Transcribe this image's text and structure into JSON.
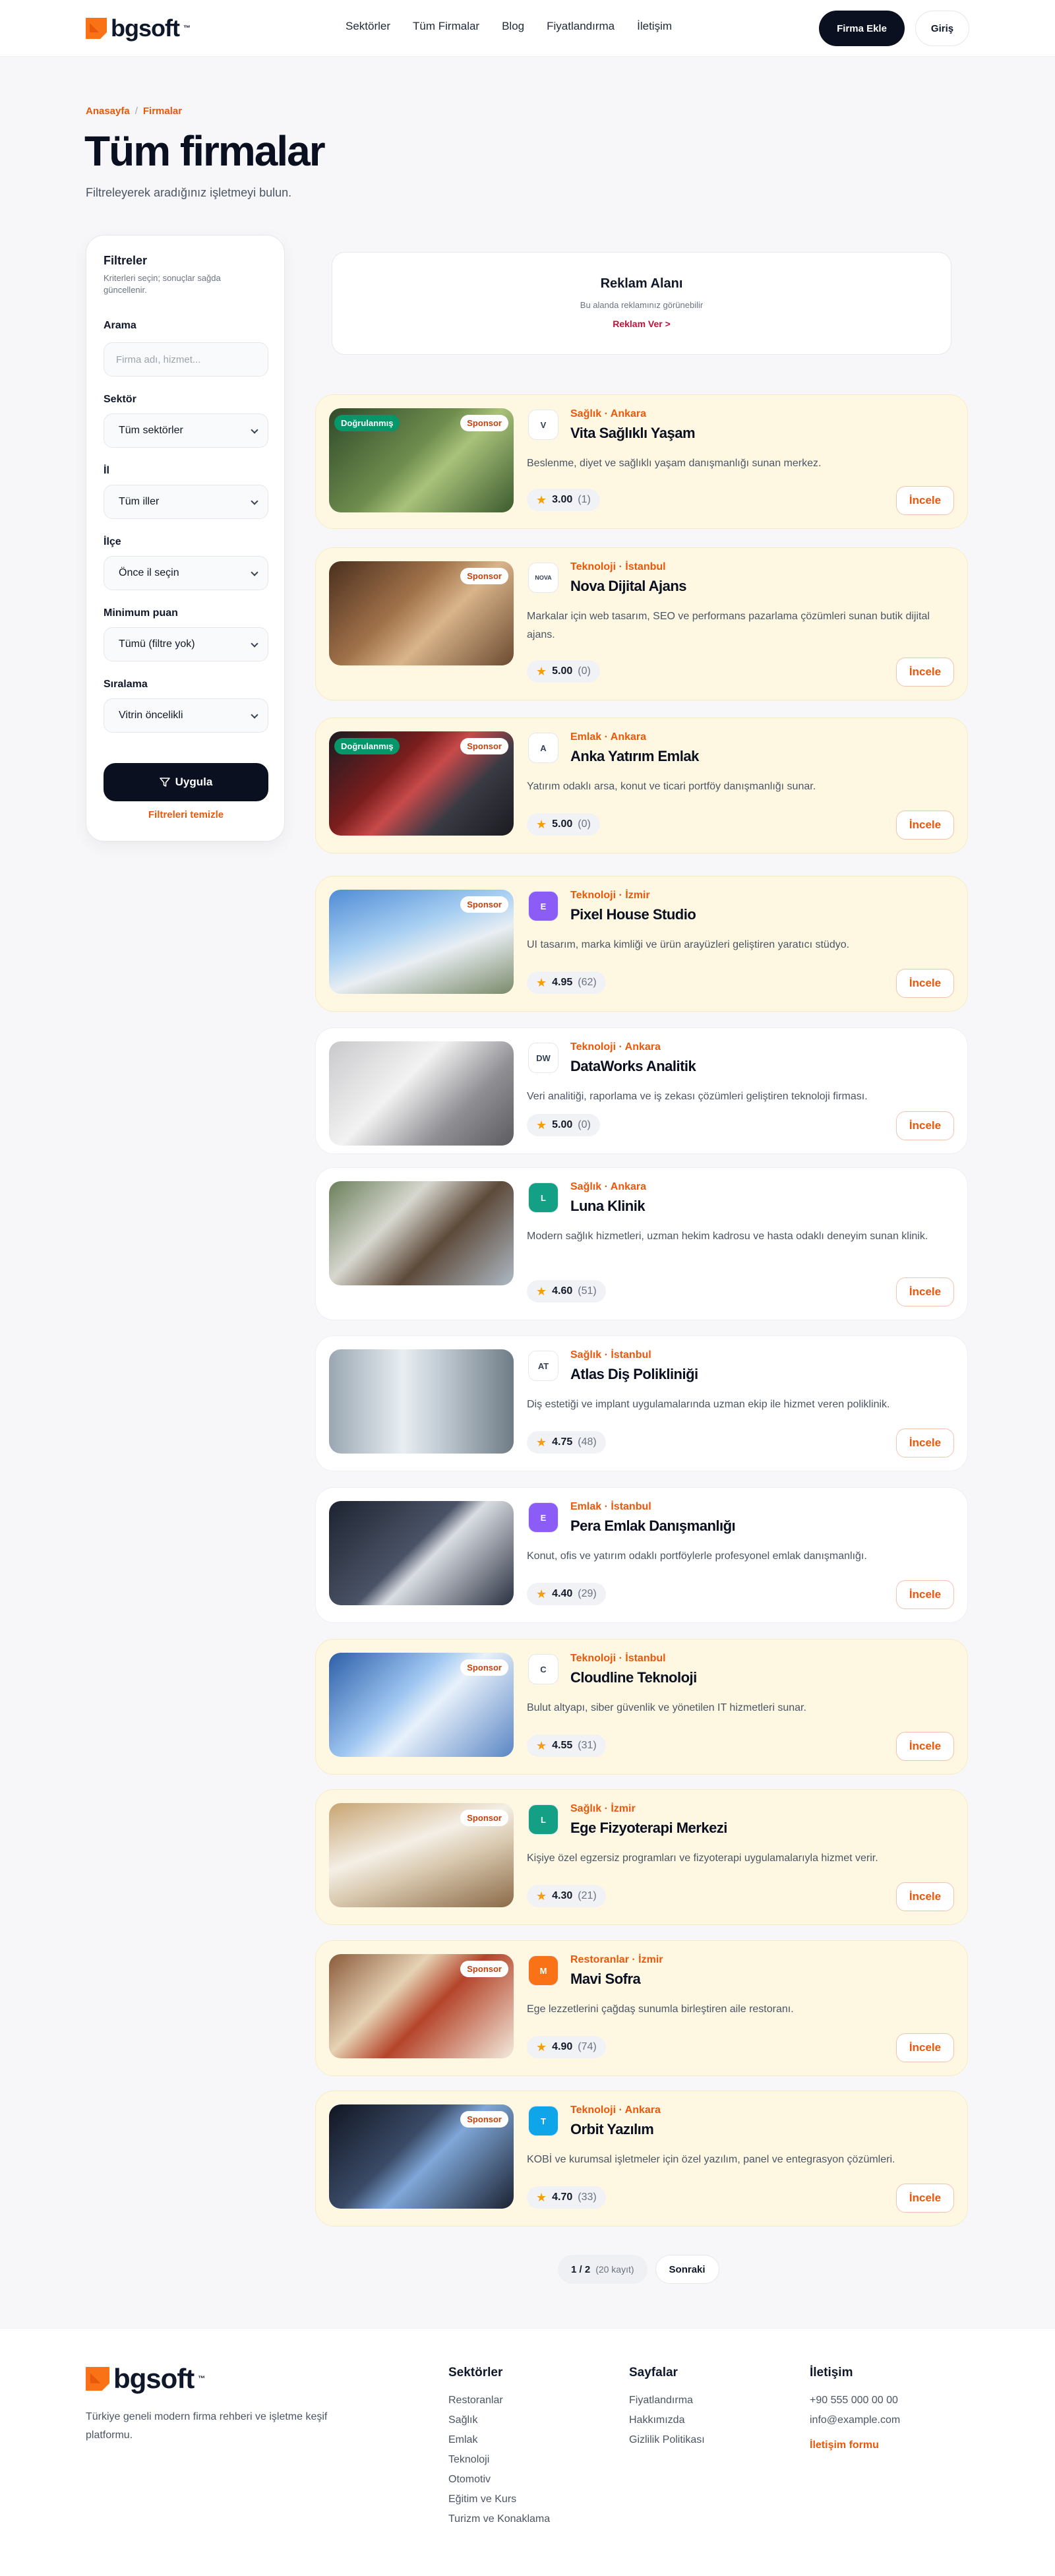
{
  "brand": {
    "name": "bgsoft",
    "tm": "™"
  },
  "nav": [
    "Sektörler",
    "Tüm Firmalar",
    "Blog",
    "Fiyatlandırma",
    "İletişim"
  ],
  "header_actions": {
    "add": "Firma Ekle",
    "login": "Giriş"
  },
  "breadcrumb": {
    "home": "Anasayfa",
    "sep": "/",
    "current": "Firmalar"
  },
  "page": {
    "title": "Tüm firmalar",
    "subtitle": "Filtreleyerek aradığınız işletmeyi bulun."
  },
  "filters": {
    "title": "Filtreler",
    "desc": "Kriterleri seçin; sonuçlar sağda güncellenir.",
    "search_label": "Arama",
    "search_placeholder": "Firma adı, hizmet...",
    "sector_label": "Sektör",
    "sector_value": "Tüm sektörler",
    "city_label": "İl",
    "city_value": "Tüm iller",
    "district_label": "İlçe",
    "district_value": "Önce il seçin",
    "rating_label": "Minimum puan",
    "rating_value": "Tümü (filtre yok)",
    "sort_label": "Sıralama",
    "sort_value": "Vitrin öncelikli",
    "apply": "Uygula",
    "clear": "Filtreleri temizle"
  },
  "ad": {
    "title": "Reklam Alanı",
    "desc": "Bu alanda reklamınız görünebilir",
    "link": "Reklam Ver >"
  },
  "badges": {
    "verified": "Doğrulanmış",
    "sponsor": "Sponsor"
  },
  "view_label": "İncele",
  "firms": [
    {
      "category": "Sağlık · Ankara",
      "name": "Vita Sağlıklı Yaşam",
      "desc": "Beslenme, diyet ve sağlıklı yaşam danışmanlığı sunan merkez.",
      "rating": "3.00",
      "count": "(1)",
      "verified": true,
      "sponsor": true,
      "logo": "V",
      "logo_color": "#ffffff"
    },
    {
      "category": "Teknoloji · İstanbul",
      "name": "Nova Dijital Ajans",
      "desc": "Markalar için web tasarım, SEO ve performans pazarlama çözümleri sunan butik dijital ajans.",
      "rating": "5.00",
      "count": "(0)",
      "verified": false,
      "sponsor": true,
      "logo": "NOVA",
      "logo_color": "#ffffff"
    },
    {
      "category": "Emlak · Ankara",
      "name": "Anka Yatırım Emlak",
      "desc": "Yatırım odaklı arsa, konut ve ticari portföy danışmanlığı sunar.",
      "rating": "5.00",
      "count": "(0)",
      "verified": true,
      "sponsor": true,
      "logo": "A",
      "logo_color": "#ffffff"
    },
    {
      "category": "Teknoloji · İzmir",
      "name": "Pixel House Studio",
      "desc": "UI tasarım, marka kimliği ve ürün arayüzleri geliştiren yaratıcı stüdyo.",
      "rating": "4.95",
      "count": "(62)",
      "verified": false,
      "sponsor": true,
      "logo": "E",
      "logo_color": "#8b5cf6"
    },
    {
      "category": "Teknoloji · Ankara",
      "name": "DataWorks Analitik",
      "desc": "Veri analitiği, raporlama ve iş zekası çözümleri geliştiren teknoloji firması.",
      "rating": "5.00",
      "count": "(0)",
      "verified": false,
      "sponsor": false,
      "logo": "DW",
      "logo_color": "#ffffff"
    },
    {
      "category": "Sağlık · Ankara",
      "name": "Luna Klinik",
      "desc": "Modern sağlık hizmetleri, uzman hekim kadrosu ve hasta odaklı deneyim sunan klinik.",
      "rating": "4.60",
      "count": "(51)",
      "verified": false,
      "sponsor": false,
      "logo": "L",
      "logo_color": "#14a085"
    },
    {
      "category": "Sağlık · İstanbul",
      "name": "Atlas Diş Polikliniği",
      "desc": "Diş estetiği ve implant uygulamalarında uzman ekip ile hizmet veren poliklinik.",
      "rating": "4.75",
      "count": "(48)",
      "verified": false,
      "sponsor": false,
      "logo": "AT",
      "logo_color": "#ffffff"
    },
    {
      "category": "Emlak · İstanbul",
      "name": "Pera Emlak Danışmanlığı",
      "desc": "Konut, ofis ve yatırım odaklı portföylerle profesyonel emlak danışmanlığı.",
      "rating": "4.40",
      "count": "(29)",
      "verified": false,
      "sponsor": false,
      "logo": "E",
      "logo_color": "#8b5cf6"
    },
    {
      "category": "Teknoloji · İstanbul",
      "name": "Cloudline Teknoloji",
      "desc": "Bulut altyapı, siber güvenlik ve yönetilen IT hizmetleri sunar.",
      "rating": "4.55",
      "count": "(31)",
      "verified": false,
      "sponsor": true,
      "logo": "C",
      "logo_color": "#ffffff"
    },
    {
      "category": "Sağlık · İzmir",
      "name": "Ege Fizyoterapi Merkezi",
      "desc": "Kişiye özel egzersiz programları ve fizyoterapi uygulamalarıyla hizmet verir.",
      "rating": "4.30",
      "count": "(21)",
      "verified": false,
      "sponsor": true,
      "logo": "L",
      "logo_color": "#14a085"
    },
    {
      "category": "Restoranlar · İzmir",
      "name": "Mavi Sofra",
      "desc": "Ege lezzetlerini çağdaş sunumla birleştiren aile restoranı.",
      "rating": "4.90",
      "count": "(74)",
      "verified": false,
      "sponsor": true,
      "logo": "M",
      "logo_color": "#f97316"
    },
    {
      "category": "Teknoloji · Ankara",
      "name": "Orbit Yazılım",
      "desc": "KOBİ ve kurumsal işletmeler için özel yazılım, panel ve entegrasyon çözümleri.",
      "rating": "4.70",
      "count": "(33)",
      "verified": false,
      "sponsor": true,
      "logo": "T",
      "logo_color": "#0ea5e9"
    }
  ],
  "pager": {
    "page": "1 / 2",
    "records": "(20 kayıt)",
    "next": "Sonraki"
  },
  "footer": {
    "desc": "Türkiye geneli modern firma rehberi ve işletme keşif platformu.",
    "col1": {
      "title": "Sektörler",
      "items": [
        "Restoranlar",
        "Sağlık",
        "Emlak",
        "Teknoloji",
        "Otomotiv",
        "Eğitim ve Kurs",
        "Turizm ve Konaklama"
      ]
    },
    "col2": {
      "title": "Sayfalar",
      "items": [
        "Fiyatlandırma",
        "Hakkımızda",
        "Gizlilik Politikası"
      ]
    },
    "col3": {
      "title": "İletişim",
      "items": [
        "+90 555 000 00 00",
        "info@example.com"
      ],
      "link": "İletişim formu"
    }
  },
  "colors": {
    "accent": "#ea580c",
    "dark": "#0b1020",
    "sponsor_bg": "#fef8e3",
    "verified": "#059669"
  }
}
